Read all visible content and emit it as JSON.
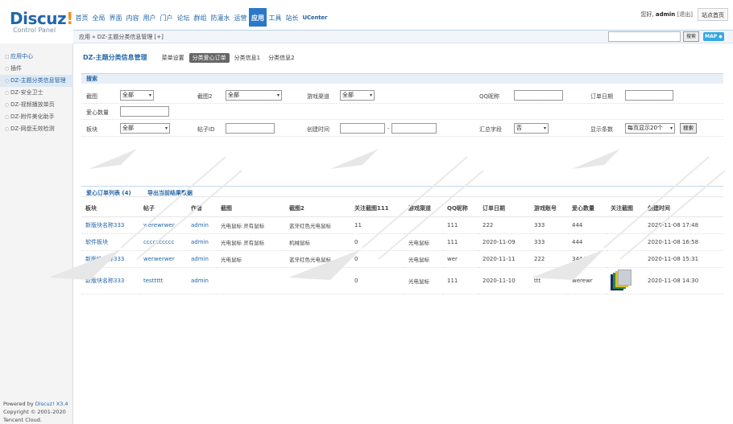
{
  "brand": {
    "name": "Discuz",
    "bang": "!",
    "subtitle": "Control Panel"
  },
  "nav": [
    {
      "label": "首页",
      "active": false
    },
    {
      "label": "全局",
      "active": false
    },
    {
      "label": "界面",
      "active": false
    },
    {
      "label": "内容",
      "active": false
    },
    {
      "label": "用户",
      "active": false
    },
    {
      "label": "门户",
      "active": false
    },
    {
      "label": "论坛",
      "active": false
    },
    {
      "label": "群组",
      "active": false
    },
    {
      "label": "防灌水",
      "active": false
    },
    {
      "label": "运营",
      "active": false
    },
    {
      "label": "应用",
      "active": true
    },
    {
      "label": "工具",
      "active": false
    },
    {
      "label": "站长",
      "active": false
    },
    {
      "label": "UCenter",
      "active": false
    }
  ],
  "user": {
    "greeting": "您好,",
    "name": "admin",
    "logout": "[退出]",
    "site_home": "站点首页"
  },
  "breadcrumb": "应用 » DZ-主题分类信息管理 [+]",
  "header_search": {
    "value": "",
    "button": "搜索",
    "map": "MAP ◆"
  },
  "sidebar": {
    "items": [
      {
        "label": "应用中心",
        "icon": "□",
        "head": true
      },
      {
        "label": "插件",
        "icon": "○"
      },
      {
        "label": "DZ-主题分类信息管理",
        "icon": "○",
        "current": true
      },
      {
        "label": "DZ-安全卫士",
        "icon": "○"
      },
      {
        "label": "DZ-视频播放单页",
        "icon": "○"
      },
      {
        "label": "DZ-附件美化助手",
        "icon": "○"
      },
      {
        "label": "DZ-网盘无效检测",
        "icon": "○"
      }
    ],
    "footer": {
      "powered": "Powered by",
      "product": "Discuz! X3.4",
      "copyright": "Copyright © 2001-2020",
      "company": "Tencent Cloud."
    }
  },
  "page": {
    "title": "DZ-主题分类信息管理",
    "tabs": [
      {
        "label": "菜单设置",
        "active": false
      },
      {
        "label": "分类爱心订单",
        "active": true
      },
      {
        "label": "分类信息1",
        "active": false
      },
      {
        "label": "分类信息2",
        "active": false
      }
    ]
  },
  "search_form": {
    "title": "搜索",
    "pic_label": "截图",
    "pic_value": "全部",
    "pic2_label": "截图2",
    "pic2_value": "全部",
    "channel_label": "游戏渠道",
    "channel_value": "全部",
    "qq_label": "QQ昵称",
    "qq_value": "",
    "date_label": "订单日期",
    "date_value": "",
    "love_label": "爱心数量",
    "love_value": "",
    "forum_label": "板块",
    "forum_value": "全部",
    "tid_label": "帖子ID",
    "tid_value": "",
    "ctime_label": "创建时间",
    "ctime_sep": "-",
    "sum_label": "汇总字段",
    "sum_value": "否",
    "perpage_label": "显示条数",
    "perpage_value": "每页显示20个",
    "search_btn": "搜索"
  },
  "list": {
    "title": "爱心订单列表 (4)",
    "export": "导出当前结果数据"
  },
  "table": {
    "headers": [
      "板块",
      "帖子",
      "作者",
      "截图",
      "截图2",
      "关注截图111",
      "游戏渠道",
      "QQ昵称",
      "订单日期",
      "游戏账号",
      "爱心数量",
      "关注截图",
      "创建时间"
    ],
    "rows": [
      [
        "新版块名称333",
        "werewrwer",
        "admin",
        "光电鼠标 灵有鼠标",
        "蓝牙红色光电鼠标",
        "11",
        "",
        "111",
        "222",
        "333",
        "444",
        "",
        "2020-11-08 17:48"
      ],
      [
        "软件板块",
        "cccccccccc",
        "admin",
        "光电鼠标 灵有鼠标",
        "机械鼠标",
        "0",
        "光电鼠标",
        "111",
        "2020-11-09",
        "333",
        "444",
        "",
        "2020-11-08 16:58"
      ],
      [
        "新版块名称333",
        "werwerwer",
        "admin",
        "光电鼠标",
        "蓝牙红色光电鼠标",
        "0",
        "光电鼠标",
        "wer",
        "2020-11-11",
        "222",
        "34444",
        "",
        "2020-11-08 15:31"
      ],
      [
        "新版块名称333",
        "testtttt",
        "admin",
        "",
        "",
        "0",
        "光电鼠标",
        "111",
        "2020-11-10",
        "ttt",
        "werewr",
        "[thumb]",
        "2020-11-08 14:30"
      ]
    ]
  },
  "colors": {
    "brand_blue": "#2366a8",
    "active_nav": "#2a78c8",
    "bang_orange": "#f4901f",
    "tab_active": "#666666"
  }
}
